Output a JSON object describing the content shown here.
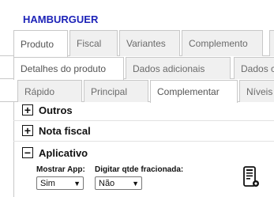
{
  "product_title": "HAMBURGUER",
  "tabs_level1": [
    "Produto",
    "Fiscal",
    "Variantes",
    "Complemento"
  ],
  "tabs_level2": [
    "Detalhes do produto",
    "Dados adicionais",
    "Dados c"
  ],
  "tabs_level3": [
    "Rápido",
    "Principal",
    "Complementar",
    "Níveis"
  ],
  "sections": [
    {
      "title": "Outros",
      "state": "+"
    },
    {
      "title": "Nota fiscal",
      "state": "+"
    },
    {
      "title": "Aplicativo",
      "state": "−"
    }
  ],
  "fields": {
    "mostrar_app": {
      "label": "Mostrar App:",
      "value": "Sim"
    },
    "digitar_qtde": {
      "label": "Digitar qtde fracionada:",
      "value": "Não"
    }
  },
  "icons": {
    "app": "mobile-phone-icon",
    "dropdown": "chevron-down-icon"
  }
}
